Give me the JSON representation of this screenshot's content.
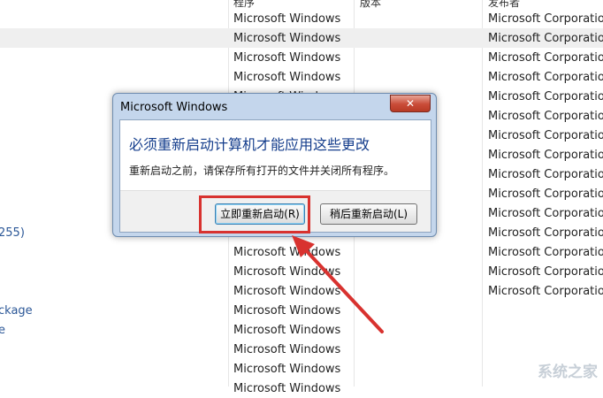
{
  "list": {
    "headers": {
      "program": "程序",
      "version": "版本",
      "publisher": "发布者"
    },
    "rows": [
      {
        "left": "",
        "program": "Microsoft Windows",
        "publisher": "Microsoft Corporation"
      },
      {
        "left": "",
        "program": "Microsoft Windows",
        "publisher": "Microsoft Corporation"
      },
      {
        "left": "",
        "program": "Microsoft Windows",
        "publisher": "Microsoft Corporation"
      },
      {
        "left": "",
        "program": "Microsoft Windows",
        "publisher": "Microsoft Corporation"
      },
      {
        "left": "",
        "program": "Microsoft Windows",
        "publisher": "Microsoft Corporation"
      },
      {
        "left": "",
        "program": "Microsoft Windows",
        "publisher": "Microsoft Corporation"
      },
      {
        "left": "",
        "program": "Microsoft Windows",
        "publisher": "Microsoft Corporation"
      },
      {
        "left": "",
        "program": "Microsoft Windows",
        "publisher": "Microsoft Corporation"
      },
      {
        "left": "",
        "program": "Microsoft Windows",
        "publisher": "Microsoft Corporation"
      },
      {
        "left": "",
        "program": "Microsoft Windows",
        "publisher": "Microsoft Corporation"
      },
      {
        "left": "",
        "program": "Microsoft Windows",
        "publisher": "Microsoft Corporation"
      },
      {
        "left": "255)",
        "program": "Microsoft Windows",
        "publisher": "Microsoft Corporation"
      },
      {
        "left": "",
        "program": "Microsoft Windows",
        "publisher": "Microsoft Corporation"
      },
      {
        "left": "",
        "program": "Microsoft Windows",
        "publisher": "Microsoft Corporation"
      },
      {
        "left": "",
        "program": "Microsoft Windows",
        "publisher": "Microsoft Corporation"
      },
      {
        "left": "ckage",
        "program": "Microsoft Windows",
        "publisher": ""
      },
      {
        "left": "e",
        "program": "Microsoft Windows",
        "publisher": ""
      },
      {
        "left": "",
        "program": "Microsoft Windows",
        "publisher": ""
      },
      {
        "left": "",
        "program": "Microsoft Windows",
        "publisher": ""
      },
      {
        "left": "",
        "program": "Microsoft Windows",
        "publisher": ""
      }
    ]
  },
  "dialog": {
    "title": "Microsoft Windows",
    "close_symbol": "✕",
    "message": "必须重新启动计算机才能应用这些更改",
    "detail": "重新启动之前，请保存所有打开的文件并关闭所有程序。",
    "restart_now_label": "立即重新启动(R)",
    "restart_later_label": "稍后重新启动(L)"
  },
  "watermark": "系统之家",
  "colors": {
    "highlight": "#d8322f",
    "arrow": "#d8322f",
    "dialog_frame": "#c4d6ec"
  }
}
